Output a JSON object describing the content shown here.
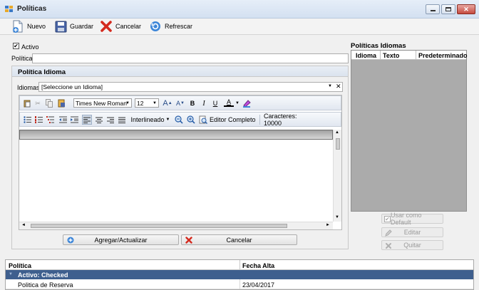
{
  "window": {
    "title": "Políticas"
  },
  "toolbar": {
    "nuevo": "Nuevo",
    "guardar": "Guardar",
    "cancelar": "Cancelar",
    "refrescar": "Refrescar"
  },
  "form": {
    "activo_label": "Activo",
    "activo_checked": true,
    "politica_label": "Política",
    "politica_value": ""
  },
  "idioma_panel": {
    "title": "Política Idioma",
    "idiomas_label": "Idiomas",
    "idiomas_value": "[Seleccione un Idioma]"
  },
  "editor": {
    "font_name": "Times New Roman",
    "font_size": "12",
    "grow_font": "A",
    "shrink_font": "A",
    "bold": "B",
    "italic": "I",
    "underline": "U",
    "font_color": "A",
    "interlineado": "Interlineado",
    "editor_completo": "Editor Completo",
    "caracteres": "Caracteres: 10000"
  },
  "buttons": {
    "agregar": "Agregar/Actualizar",
    "cancelar": "Cancelar"
  },
  "politicas_idiomas": {
    "title": "Políticas Idiomas",
    "columns": [
      "Idioma",
      "Texto",
      "Predeterminado"
    ],
    "usar_default": "Usar como Default",
    "editar": "Editar",
    "quitar": "Quitar"
  },
  "grid": {
    "columns": [
      "Política",
      "Fecha Alta"
    ],
    "group_label": "Activo: Checked",
    "rows": [
      {
        "politica": "Politica de Reserva",
        "fecha": "23/04/2017"
      }
    ]
  },
  "colors": {
    "group_bar": "#3e5f8e",
    "title_grad": "#d3e0f1",
    "close": "#c54b3f"
  }
}
